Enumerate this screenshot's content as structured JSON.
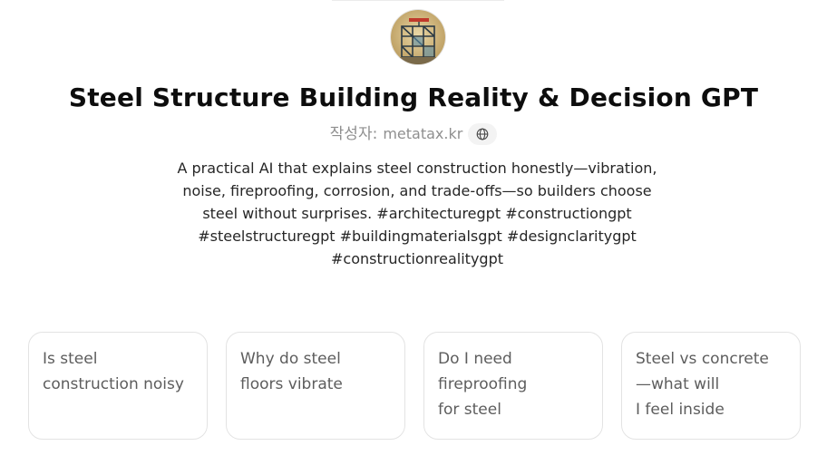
{
  "gpt": {
    "title": "Steel Structure Building Reality & Decision GPT",
    "author_label": "작성자:",
    "author_name": "metatax.kr",
    "description": "A practical AI that explains steel construction honestly—vibration,\nnoise, fireproofing, corrosion, and trade-offs—so builders choose\nsteel without surprises. #architecturegpt #constructiongpt\n#steelstructuregpt #buildingmaterialsgpt #designclaritygpt\n#constructionrealitygpt"
  },
  "icons": {
    "avatar": "steel-building-avatar-icon",
    "author_link": "globe-icon"
  },
  "conversation_starters": [
    {
      "text": "Is steel\nconstruction noisy"
    },
    {
      "text": "Why do steel\nfloors vibrate"
    },
    {
      "text": "Do I need\nfireproofing\nfor steel"
    },
    {
      "text": "Steel vs concrete\n—what will\nI feel inside"
    }
  ]
}
